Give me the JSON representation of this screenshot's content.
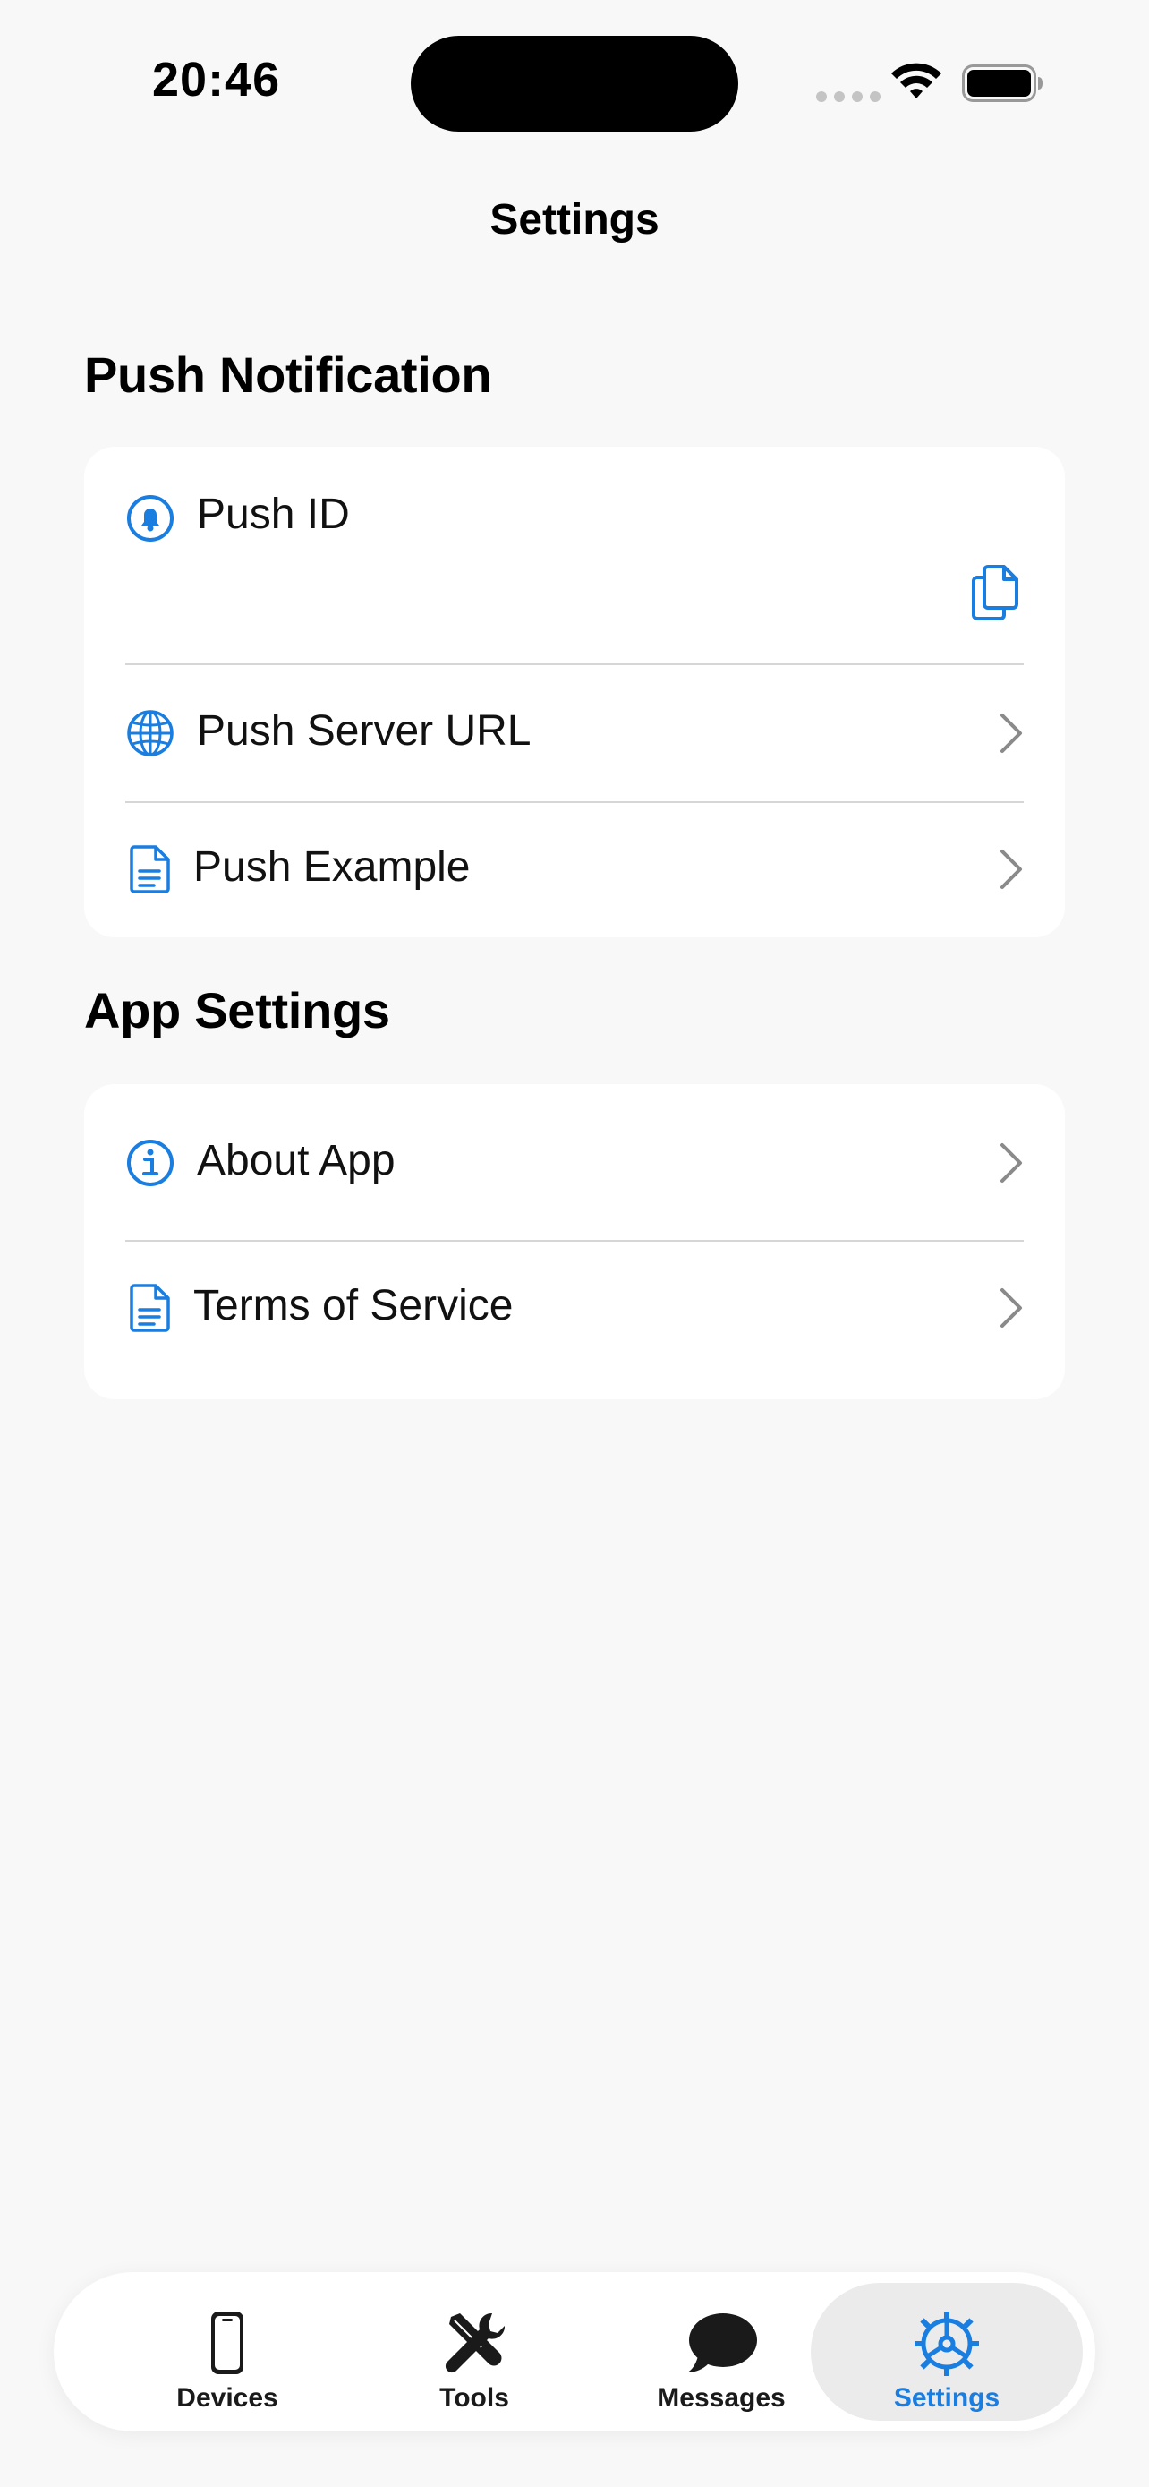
{
  "status_bar": {
    "time": "20:46"
  },
  "nav": {
    "title": "Settings"
  },
  "sections": {
    "push": {
      "header": "Push Notification",
      "push_id_label": "Push ID",
      "push_server_url_label": "Push Server URL",
      "push_example_label": "Push Example"
    },
    "app": {
      "header": "App Settings",
      "about_label": "About App",
      "terms_label": "Terms of Service"
    }
  },
  "tabbar": {
    "devices": "Devices",
    "tools": "Tools",
    "messages": "Messages",
    "settings": "Settings",
    "active": "settings"
  },
  "colors": {
    "accent": "#1a7de0",
    "background": "#f8f8f8",
    "card": "#ffffff"
  }
}
